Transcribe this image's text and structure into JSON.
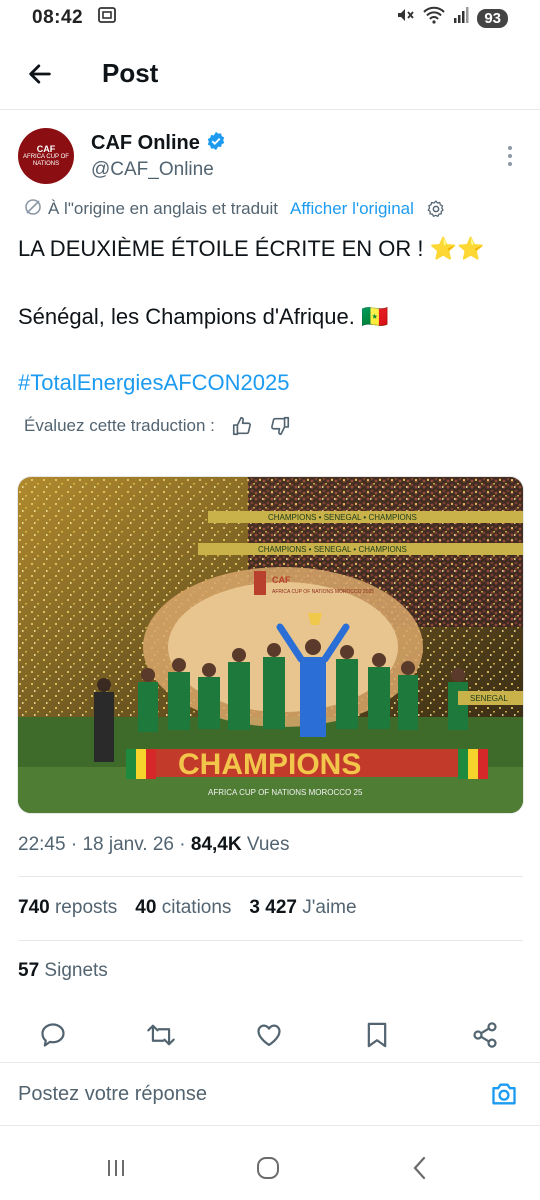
{
  "status_bar": {
    "time": "08:42",
    "battery": "93",
    "icons": [
      "screenshot-icon",
      "mute-icon",
      "wifi-icon",
      "signal-icon"
    ]
  },
  "header": {
    "title": "Post",
    "back_icon": "arrow-left-icon"
  },
  "author": {
    "name": "CAF Online",
    "handle": "@CAF_Online",
    "verified": true,
    "avatar_text": "CAF",
    "avatar_sub": "AFRICA CUP OF NATIONS",
    "verified_color": "#1d9bf0"
  },
  "translation": {
    "note": "À l\"origine en anglais et traduit",
    "show_original": "Afficher l'original"
  },
  "tweet": {
    "line1": "LA DEUXIÈME ÉTOILE ÉCRITE EN OR ! ⭐⭐",
    "line2": "Sénégal, les Champions d'Afrique. 🇸🇳",
    "hashtag": "#TotalEnergiesAFCON2025"
  },
  "rate": {
    "label": "Évaluez cette traduction :"
  },
  "media": {
    "banner_1": "CHAMPIONS  •  SENEGAL  •  CHAMPIONS",
    "banner_2": "CHAMPIONS  •  SENEGAL  •  CHAMPIONS",
    "podium_text": "CHAMPIONS",
    "podium_sub": "AFRICA CUP OF NATIONS MOROCCO 25",
    "logo_text": "CAF",
    "logo_sub": "AFRICA CUP OF NATIONS MOROCCO 2025",
    "board_text": "SENEGAL"
  },
  "meta": {
    "time": "22:45",
    "date": "18 janv. 26",
    "views_count": "84,4K",
    "views_label": "Vues"
  },
  "stats": {
    "reposts_count": "740",
    "reposts_label": "reposts",
    "quotes_count": "40",
    "quotes_label": "citations",
    "likes_count": "3 427",
    "likes_label": "J'aime",
    "bookmarks_count": "57",
    "bookmarks_label": "Signets"
  },
  "reply": {
    "placeholder": "Postez votre réponse"
  },
  "colors": {
    "accent": "#1d9bf0",
    "secondary_text": "#536471",
    "primary_text": "#0f1419",
    "divider": "#e6e8ea"
  }
}
